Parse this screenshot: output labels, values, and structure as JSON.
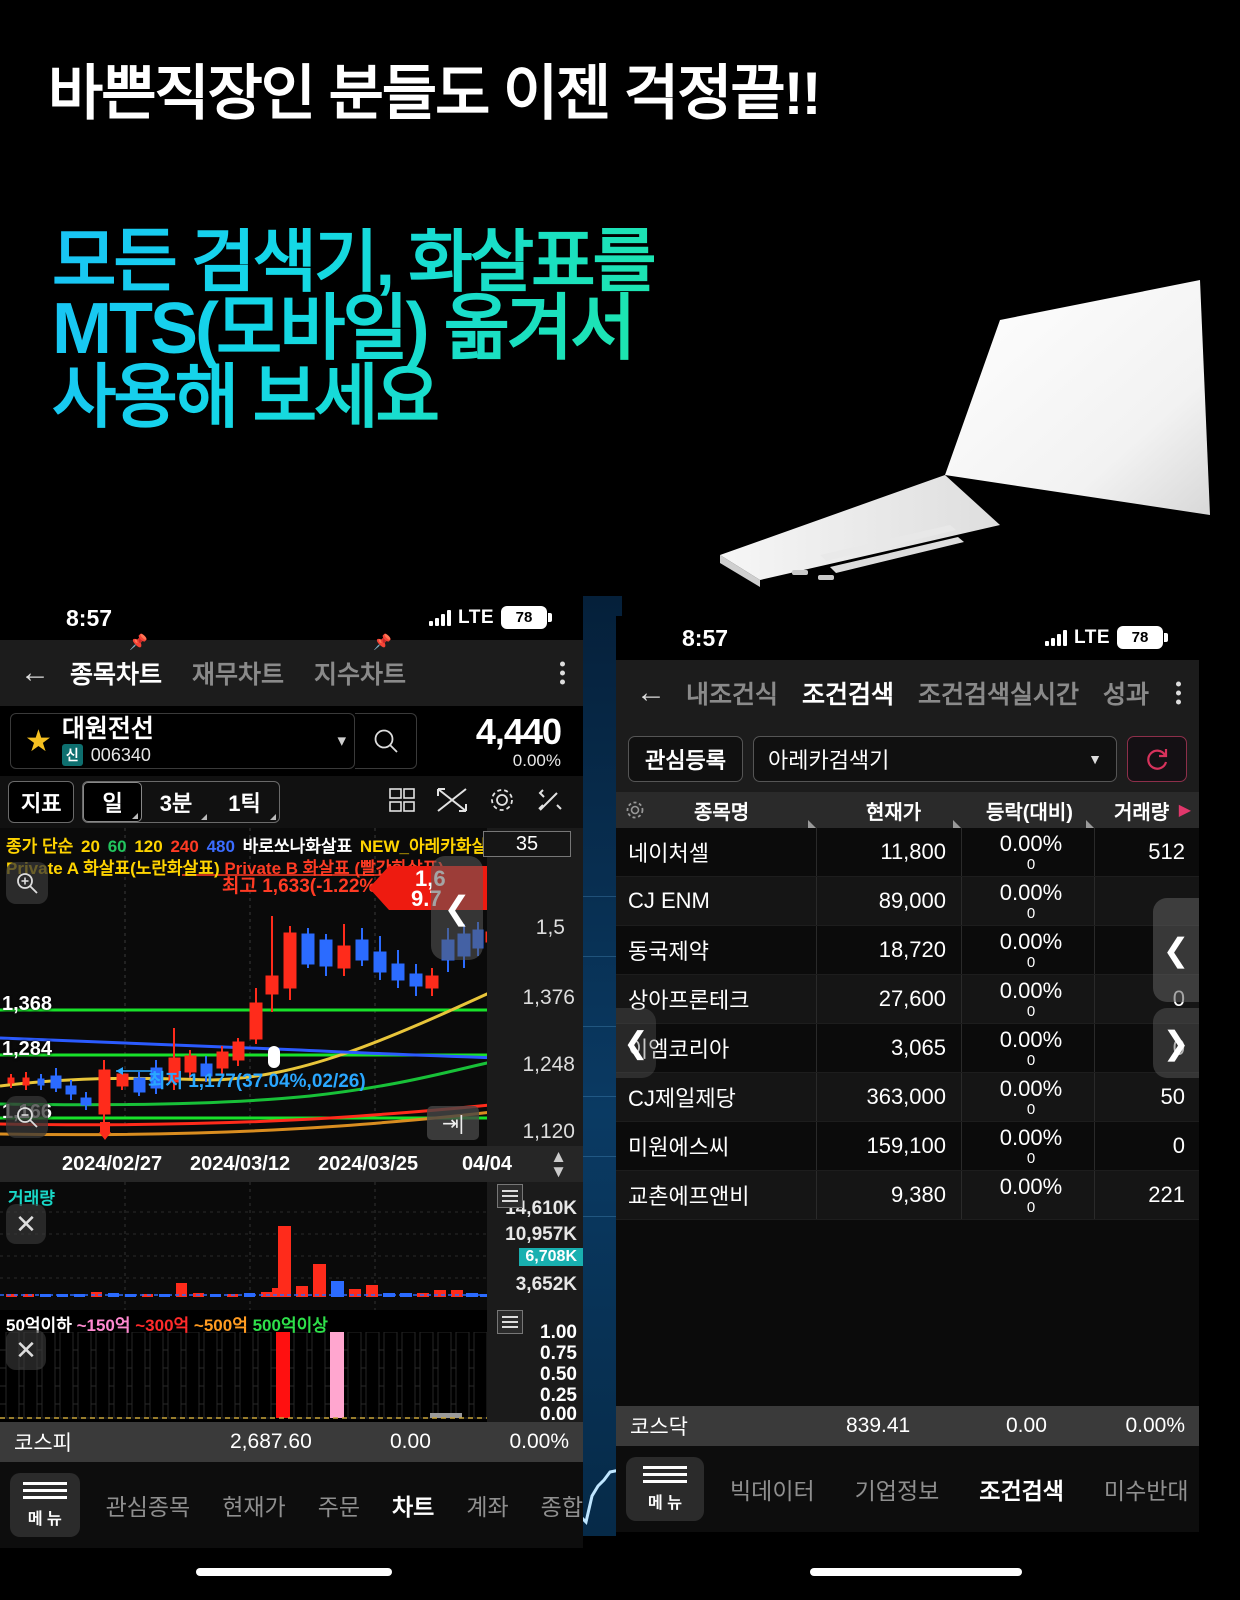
{
  "promo": {
    "headline": "바쁜직장인 분들도 이젠 걱정끝!!",
    "sub_line1": "모든 검색기, 화살표를",
    "sub_line2": "MTS(모바일) 옮겨서",
    "sub_line3": "사용해 보세요",
    "headline_color": "#ffffff",
    "sub_gradient_from": "#19c3f5",
    "sub_gradient_to": "#1ee6a8"
  },
  "left_phone": {
    "status": {
      "time": "8:57",
      "network": "LTE",
      "battery": "78"
    },
    "nav": {
      "back_icon": "back-arrow-icon",
      "tabs": [
        {
          "label": "종목차트",
          "active": true,
          "pin": true
        },
        {
          "label": "재무차트",
          "active": false,
          "pin": false
        },
        {
          "label": "지수차트",
          "active": false,
          "pin": true
        }
      ],
      "more_icon": "kebab-menu-icon"
    },
    "stock": {
      "favorite_icon": "star-icon",
      "name": "대원전선",
      "badge": "신",
      "code": "006340",
      "dropdown_icon": "chevron-down-icon",
      "search_icon": "search-icon",
      "price": "4,440",
      "change_pct": "0.00%"
    },
    "toolbar": {
      "indicator_label": "지표",
      "periods": [
        {
          "label": "일",
          "selected": true
        },
        {
          "label": "3분",
          "selected": false
        },
        {
          "label": "1틱",
          "selected": false
        }
      ],
      "icons": [
        "grid-icon",
        "expand-icon",
        "gear-icon",
        "tools-icon"
      ]
    },
    "chart": {
      "legend_line1": [
        {
          "text": "종가 단순",
          "color": "#ffd400"
        },
        {
          "text": "20",
          "color": "#ffd400"
        },
        {
          "text": "60",
          "color": "#22c55e"
        },
        {
          "text": "120",
          "color": "#ffd400"
        },
        {
          "text": "240",
          "color": "#ff3b24"
        },
        {
          "text": "480",
          "color": "#3b6cff"
        },
        {
          "text": "바로쏘나화살표",
          "color": "#ffffff"
        },
        {
          "text": "NEW_아레카화살표",
          "color": "#ffd400"
        }
      ],
      "legend_line2": [
        {
          "text": "Private A 화살표(노란화살표)",
          "color": "#ffd400"
        },
        {
          "text": "Private B 화살표 (빨간화살표)",
          "color": "#ff3b24"
        },
        {
          "text": "...",
          "color": "#cccccc"
        }
      ],
      "count_badge": "35",
      "high_label": "최고 1,633(-1.22%,04/04)",
      "low_label": "최저 1,177(37.04%,02/26)",
      "price_lines": [
        "1,368",
        "1,284",
        "1,166"
      ],
      "y_ticks": [
        "1,376",
        "1,248",
        "1,120"
      ],
      "current_flag_line1": "1,6",
      "current_flag_line2": "9.7",
      "dates": [
        "2024/02/27",
        "2024/03/12",
        "2024/03/25",
        "04/04"
      ],
      "zoom_in_icon": "zoom-in-icon",
      "zoom_out_icon": "zoom-out-icon",
      "to_end_icon": "jump-to-end-icon",
      "prev_page_icon": "chevron-left-icon"
    },
    "volume": {
      "title": "거래량",
      "close_icon": "close-icon",
      "menu_icon": "hamburger-icon",
      "ticks": [
        "14,610K",
        "10,957K",
        "3,652K"
      ],
      "highlight": "6,708K"
    },
    "indicator": {
      "legend": [
        {
          "text": "50억이하",
          "color": "#ffffff"
        },
        {
          "text": "~150억",
          "color": "#ff8ad1"
        },
        {
          "text": "~300억",
          "color": "#ff2b2b"
        },
        {
          "text": "~500억",
          "color": "#ff9b21"
        },
        {
          "text": "500억이상",
          "color": "#2ee04a"
        }
      ],
      "close_icon": "close-icon",
      "menu_icon": "hamburger-icon",
      "ticks": [
        "1.00",
        "0.75",
        "0.50",
        "0.25",
        "0.00"
      ]
    },
    "index_footer": {
      "name": "코스피",
      "value": "2,687.60",
      "change": "0.00",
      "pct": "0.00%"
    },
    "tabbar": {
      "menu_label": "메 뉴",
      "menu_icon": "hamburger-icon",
      "tabs": [
        {
          "label": "관심종목",
          "active": false
        },
        {
          "label": "현재가",
          "active": false
        },
        {
          "label": "주문",
          "active": false
        },
        {
          "label": "차트",
          "active": true
        },
        {
          "label": "계좌",
          "active": false
        },
        {
          "label": "종합",
          "active": false
        }
      ]
    }
  },
  "right_phone": {
    "status": {
      "time": "8:57",
      "network": "LTE",
      "battery": "78"
    },
    "nav": {
      "back_icon": "back-arrow-icon",
      "tabs": [
        {
          "label": "내조건식",
          "active": false
        },
        {
          "label": "조건검색",
          "active": true
        },
        {
          "label": "조건검색실시간",
          "active": false
        },
        {
          "label": "성과",
          "active": false
        }
      ],
      "more_icon": "kebab-menu-icon"
    },
    "condition": {
      "watch_button": "관심등록",
      "selected_screener": "아레카검색기",
      "dropdown_icon": "chevron-down-icon",
      "refresh_icon": "refresh-icon",
      "gear_icon": "gear-icon",
      "play_icon": "play-icon"
    },
    "table": {
      "columns": [
        "종목명",
        "현재가",
        "등락(대비)",
        "거래량"
      ],
      "rows": [
        {
          "name": "네이처셀",
          "price": "11,800",
          "pct": "0.00%",
          "diff": "0",
          "volume": "512"
        },
        {
          "name": "CJ ENM",
          "price": "89,000",
          "pct": "0.00%",
          "diff": "0",
          "volume": ""
        },
        {
          "name": "동국제약",
          "price": "18,720",
          "pct": "0.00%",
          "diff": "0",
          "volume": ""
        },
        {
          "name": "상아프론테크",
          "price": "27,600",
          "pct": "0.00%",
          "diff": "0",
          "volume": "0"
        },
        {
          "name": "이엠코리아",
          "price": "3,065",
          "pct": "0.00%",
          "diff": "0",
          "volume": "0"
        },
        {
          "name": "CJ제일제당",
          "price": "363,000",
          "pct": "0.00%",
          "diff": "0",
          "volume": "50"
        },
        {
          "name": "미원에스씨",
          "price": "159,100",
          "pct": "0.00%",
          "diff": "0",
          "volume": "0"
        },
        {
          "name": "교촌에프앤비",
          "price": "9,380",
          "pct": "0.00%",
          "diff": "0",
          "volume": "221"
        }
      ],
      "prev_icon": "chevron-left-icon",
      "next_icon": "chevron-right-icon"
    },
    "index_footer": {
      "name": "코스닥",
      "value": "839.41",
      "change": "0.00",
      "pct": "0.00%"
    },
    "tabbar": {
      "menu_label": "메 뉴",
      "menu_icon": "hamburger-icon",
      "tabs": [
        {
          "label": "빅데이터",
          "active": false
        },
        {
          "label": "기업정보",
          "active": false
        },
        {
          "label": "조건검색",
          "active": true
        },
        {
          "label": "미수반대",
          "active": false
        }
      ]
    }
  },
  "chart_data": {
    "type": "line",
    "title": "대원전선 006340 일봉",
    "xlabel": "",
    "ylabel": "",
    "ylim": [
      1100,
      1700
    ],
    "x_tick_labels": [
      "2024/02/27",
      "2024/03/12",
      "2024/03/25",
      "04/04"
    ],
    "y_tick_labels": [
      "1,376",
      "1,248",
      "1,120"
    ],
    "annotations": [
      {
        "text": "최고 1,633(-1.22%,04/04)",
        "value": 1633,
        "color": "#ff3b24"
      },
      {
        "text": "최저 1,177(37.04%,02/26)",
        "value": 1177,
        "color": "#2aa7ff"
      }
    ],
    "horizontal_lines": [
      {
        "label": "1,368",
        "value": 1368,
        "color": "#22c55e"
      },
      {
        "label": "1,284",
        "value": 1284,
        "color": "#22c55e"
      },
      {
        "label": "1,166",
        "value": 1166,
        "color": "#22c55e"
      }
    ],
    "volume_ticks": [
      "14,610K",
      "10,957K",
      "6,708K",
      "3,652K"
    ],
    "indicator_ticks": [
      "1.00",
      "0.75",
      "0.50",
      "0.25",
      "0.00"
    ],
    "legend": [
      "종가 단순 20",
      "60",
      "120",
      "240",
      "480",
      "바로쏘나화살표",
      "NEW_아레카화살표",
      "Private A 화살표(노란화살표)",
      "Private B 화살표 (빨간화살표)"
    ]
  }
}
